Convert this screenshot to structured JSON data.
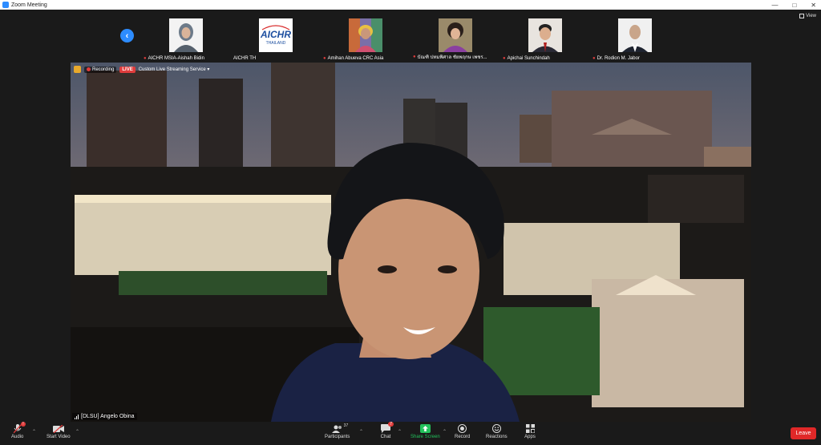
{
  "window": {
    "title": "Zoom Meeting"
  },
  "gallery": {
    "view_label": "View",
    "participants": [
      {
        "name": "AICHR MSIA-Aishah Bidin",
        "muted": true
      },
      {
        "name": "AICHR TH",
        "muted": false,
        "logo_text": "AICHR",
        "logo_sub": "THAILAND"
      },
      {
        "name": "Amihan Abueva CRC Asia",
        "muted": true
      },
      {
        "name": "บัณฑิ ปทมพิศาล ชัยพฤกษ เพชร...",
        "muted": true
      },
      {
        "name": "Apichai Sunchindah",
        "muted": true
      },
      {
        "name": "Dr. Rodion M. Jabor",
        "muted": true
      }
    ]
  },
  "stage": {
    "recording_label": "Recording",
    "live_label": "LIVE",
    "stream_label": "Custom Live Streaming Service",
    "speaker_name": "[DLSU] Angelo Obina"
  },
  "toolbar": {
    "audio": "Audio",
    "start_video": "Start Video",
    "participants": "Participants",
    "participants_count": "37",
    "chat": "Chat",
    "chat_badge": "7",
    "share_screen": "Share Screen",
    "record": "Record",
    "reactions": "Reactions",
    "apps": "Apps",
    "leave": "Leave"
  },
  "colors": {
    "accent": "#2d8cff",
    "share": "#23c25c",
    "leave": "#e02828",
    "live": "#e03c3c"
  }
}
